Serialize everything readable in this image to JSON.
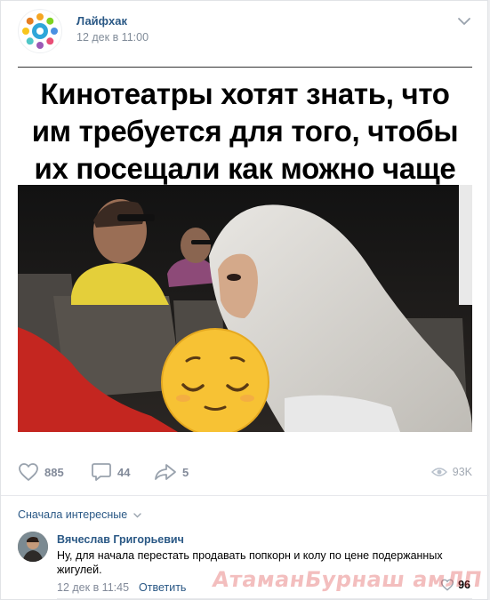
{
  "post": {
    "author": "Лайфхак",
    "date": "12 дек в 11:00",
    "headline_lines": [
      "Кинотеатры хотят знать, что",
      "им требуется для того, чтобы",
      "их посещали как можно чаще"
    ]
  },
  "actions": {
    "likes": "885",
    "comments": "44",
    "shares": "5",
    "views": "93K"
  },
  "comments": {
    "sort_label": "Сначала интересные",
    "items": [
      {
        "author": "Вячеслав Григорьевич",
        "text": "Ну, для начала перестать продавать попкорн и колу по цене подержанных жигулей.",
        "date": "12 дек в 11:45",
        "reply_label": "Ответить",
        "likes": "96"
      }
    ]
  },
  "watermark": "АтаманБурнаш амЛП",
  "colors": {
    "link": "#2a5885",
    "meta": "#818c99",
    "icon": "#99a2ad"
  }
}
